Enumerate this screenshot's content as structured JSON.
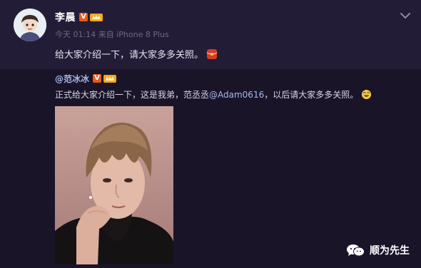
{
  "post": {
    "author": "李晨",
    "time": "今天 01:14",
    "source_prefix": "来自",
    "device": "iPhone 8 Plus",
    "text": "给大家介绍一下，请大家多多关照。"
  },
  "repost": {
    "author": "@范冰冰",
    "text_before": "正式给大家介绍一下，这是我弟，范丞丞",
    "mention": "@Adam0616",
    "text_after": "，以后请大家多多关照。"
  },
  "watermark": {
    "label": "顺为先生"
  },
  "colors": {
    "background": "#221b36",
    "repost_background": "#1a1429",
    "verified_badge": "#e85b1b",
    "link": "#a7b8e8"
  },
  "icons": {
    "verified": "verified-v-badge-icon",
    "level": "member-level-badge-icon",
    "more": "chevron-down-icon",
    "emoji_post": "red-envelope-emoji-icon",
    "emoji_repost": "laughing-emoji-icon",
    "wechat": "wechat-icon"
  }
}
